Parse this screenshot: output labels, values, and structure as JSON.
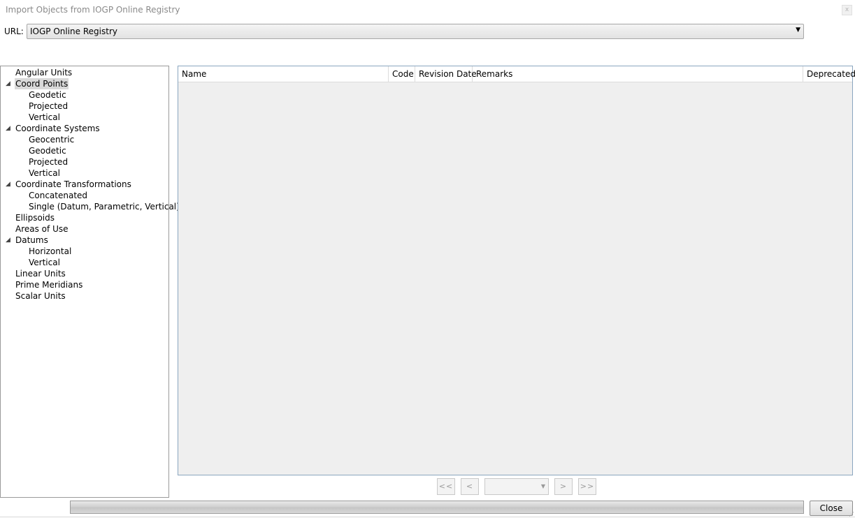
{
  "window": {
    "title": "Import Objects from IOGP Online Registry",
    "close_glyph": "x"
  },
  "url": {
    "label": "URL:",
    "selected": "IOGP Online Registry",
    "arrow_icon": "▼"
  },
  "tree": {
    "expander_icon": "◢",
    "items": [
      {
        "label": "Angular Units",
        "level": 0,
        "expander": false
      },
      {
        "label": "Coord Points",
        "level": 0,
        "expander": true,
        "selected": true
      },
      {
        "label": "Geodetic",
        "level": 1
      },
      {
        "label": "Projected",
        "level": 1
      },
      {
        "label": "Vertical",
        "level": 1
      },
      {
        "label": "Coordinate Systems",
        "level": 0,
        "expander": true
      },
      {
        "label": "Geocentric",
        "level": 1
      },
      {
        "label": "Geodetic",
        "level": 1
      },
      {
        "label": "Projected",
        "level": 1
      },
      {
        "label": "Vertical",
        "level": 1
      },
      {
        "label": "Coordinate Transformations",
        "level": 0,
        "expander": true
      },
      {
        "label": "Concatenated",
        "level": 1
      },
      {
        "label": "Single (Datum, Parametric, Vertical)",
        "level": 1
      },
      {
        "label": "Ellipsoids",
        "level": 0,
        "expander": false
      },
      {
        "label": "Areas of Use",
        "level": 0,
        "expander": false
      },
      {
        "label": "Datums",
        "level": 0,
        "expander": true
      },
      {
        "label": "Horizontal",
        "level": 1
      },
      {
        "label": "Vertical",
        "level": 1
      },
      {
        "label": "Linear Units",
        "level": 0,
        "expander": false
      },
      {
        "label": "Prime Meridians",
        "level": 0,
        "expander": false
      },
      {
        "label": "Scalar Units",
        "level": 0,
        "expander": false
      }
    ]
  },
  "grid": {
    "columns": {
      "name": "Name",
      "code": "Code",
      "revision_date": "Revision Date",
      "remarks": "Remarks",
      "deprecated": "Deprecated"
    }
  },
  "pager": {
    "first": "<<",
    "prev": "<",
    "page_value": "",
    "arrow_icon": "▼",
    "next": ">",
    "last": ">>"
  },
  "footer": {
    "close_label": "Close",
    "grip_icon": "⋰"
  }
}
